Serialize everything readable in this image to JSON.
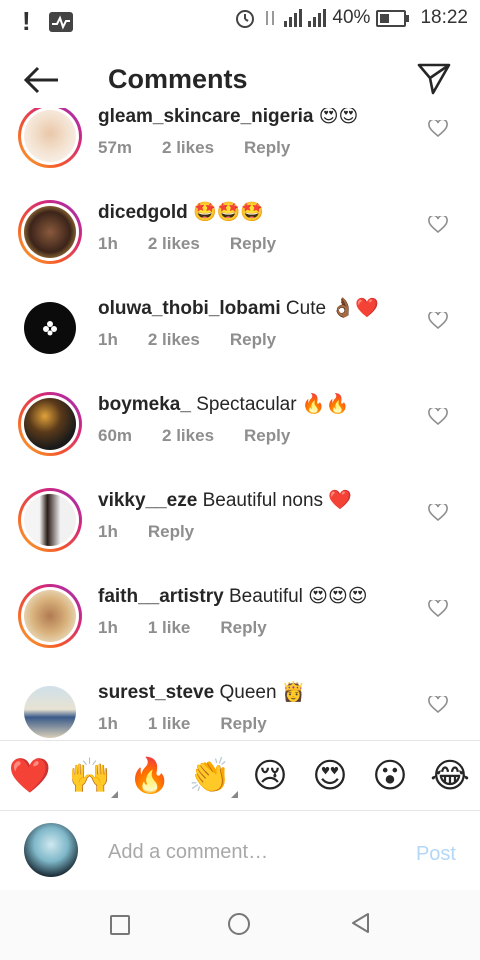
{
  "status_bar": {
    "battery": "40%",
    "time": "18:22"
  },
  "header": {
    "title": "Comments"
  },
  "comments": [
    {
      "username": "gleam_skincare_nigeria",
      "text": "😍😍",
      "time": "57m",
      "likes": "2 likes",
      "reply": "Reply"
    },
    {
      "username": "dicedgold",
      "text": "🤩🤩🤩",
      "time": "1h",
      "likes": "2 likes",
      "reply": "Reply"
    },
    {
      "username": "oluwa_thobi_lobami",
      "text": "Cute 👌🏾❤️",
      "time": "1h",
      "likes": "2 likes",
      "reply": "Reply"
    },
    {
      "username": "boymeka_",
      "text": "Spectacular 🔥🔥",
      "time": "60m",
      "likes": "2 likes",
      "reply": "Reply"
    },
    {
      "username": "vikky__eze",
      "text": "Beautiful nons ❤️",
      "time": "1h",
      "likes": "",
      "reply": "Reply"
    },
    {
      "username": "faith__artistry",
      "text": "Beautiful 😍😍😍",
      "time": "1h",
      "likes": "1 like",
      "reply": "Reply"
    },
    {
      "username": "surest_steve",
      "text": "Queen 👸",
      "time": "1h",
      "likes": "1 like",
      "reply": "Reply"
    }
  ],
  "reactions": [
    "❤️",
    "🙌",
    "🔥",
    "👏",
    "😢",
    "😍",
    "😮",
    "😂"
  ],
  "composer": {
    "placeholder": "Add a comment…",
    "post_label": "Post"
  },
  "colors": {
    "ring_start": "#f9b233",
    "ring_end": "#962fbf",
    "post_disabled": "#b3d7f8",
    "meta_gray": "#8e8e8e"
  }
}
